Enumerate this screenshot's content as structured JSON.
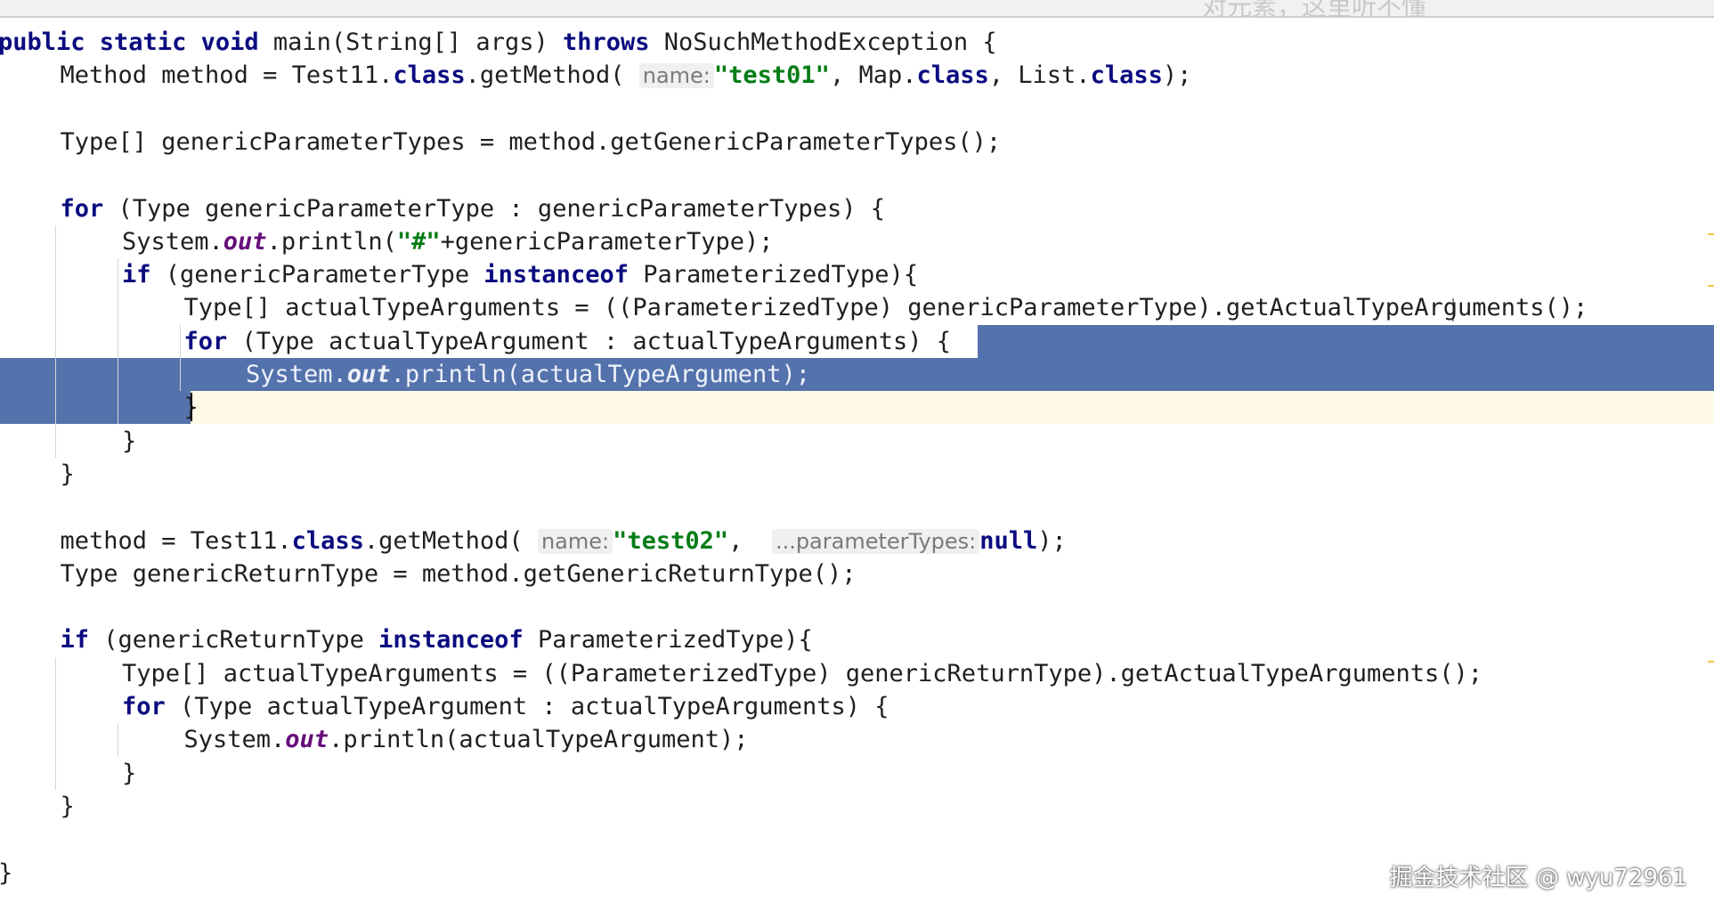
{
  "top_note": "对元素，这里听不懂",
  "editor": {
    "lines": [
      {
        "id": "l1",
        "indent": 0,
        "tokens": [
          [
            "kw",
            "public static void "
          ],
          [
            "",
            "main(String[] args) "
          ],
          [
            "kw",
            "throws "
          ],
          [
            "",
            "NoSuchMethodException {"
          ]
        ]
      },
      {
        "id": "l2",
        "indent": 1,
        "tokens": [
          [
            "",
            "Method method = Test11."
          ],
          [
            "kw",
            "class"
          ],
          [
            "",
            ".getMethod( "
          ],
          [
            "hint",
            "name:"
          ],
          [
            "str",
            "\"test01\""
          ],
          [
            "",
            ", Map."
          ],
          [
            "kw",
            "class"
          ],
          [
            "",
            ", List."
          ],
          [
            "kw",
            "class"
          ],
          [
            "",
            ");"
          ]
        ]
      },
      {
        "id": "l3",
        "indent": 0,
        "tokens": []
      },
      {
        "id": "l4",
        "indent": 1,
        "tokens": [
          [
            "",
            "Type[] genericParameterTypes = method.getGenericParameterTypes();"
          ]
        ]
      },
      {
        "id": "l5",
        "indent": 0,
        "tokens": []
      },
      {
        "id": "l6",
        "indent": 1,
        "tokens": [
          [
            "kw",
            "for "
          ],
          [
            "",
            "(Type genericParameterType : genericParameterTypes) {"
          ]
        ]
      },
      {
        "id": "l7",
        "indent": 2,
        "tokens": [
          [
            "",
            "System."
          ],
          [
            "fld",
            "out"
          ],
          [
            "",
            ".println("
          ],
          [
            "str",
            "\"#\""
          ],
          [
            "",
            "+genericParameterType);"
          ]
        ]
      },
      {
        "id": "l8",
        "indent": 2,
        "tokens": [
          [
            "kw",
            "if "
          ],
          [
            "",
            "(genericParameterType "
          ],
          [
            "kw",
            "instanceof "
          ],
          [
            "",
            "ParameterizedType){"
          ]
        ]
      },
      {
        "id": "l9",
        "indent": 3,
        "tokens": [
          [
            "",
            "Type[] actualTypeArguments = ((ParameterizedType) genericParameterType).getActualTypeArguments();"
          ]
        ]
      },
      {
        "id": "l10",
        "indent": 3,
        "tokens": [
          [
            "kw",
            "for "
          ],
          [
            "",
            "(Type actualTypeArgument : actualTypeArguments) {"
          ]
        ]
      },
      {
        "id": "l11",
        "indent": 4,
        "tokens": [
          [
            "",
            "System."
          ],
          [
            "fld",
            "out"
          ],
          [
            "",
            ".println(actualTypeArgument);"
          ]
        ]
      },
      {
        "id": "l12",
        "indent": 3,
        "tokens": [
          [
            "",
            "}"
          ]
        ]
      },
      {
        "id": "l13",
        "indent": 2,
        "tokens": [
          [
            "",
            "}"
          ]
        ]
      },
      {
        "id": "l14",
        "indent": 1,
        "tokens": [
          [
            "",
            "}"
          ]
        ]
      },
      {
        "id": "l15",
        "indent": 0,
        "tokens": []
      },
      {
        "id": "l16",
        "indent": 1,
        "tokens": [
          [
            "",
            "method = Test11."
          ],
          [
            "kw",
            "class"
          ],
          [
            "",
            ".getMethod( "
          ],
          [
            "hint",
            "name:"
          ],
          [
            "str",
            "\"test02\""
          ],
          [
            "",
            ",  "
          ],
          [
            "hint",
            "...parameterTypes:"
          ],
          [
            "kw",
            "null"
          ],
          [
            "",
            ");"
          ]
        ]
      },
      {
        "id": "l17",
        "indent": 1,
        "tokens": [
          [
            "",
            "Type genericReturnType = method.getGenericReturnType();"
          ]
        ]
      },
      {
        "id": "l18",
        "indent": 0,
        "tokens": []
      },
      {
        "id": "l19",
        "indent": 1,
        "tokens": [
          [
            "kw",
            "if "
          ],
          [
            "",
            "(genericReturnType "
          ],
          [
            "kw",
            "instanceof "
          ],
          [
            "",
            "ParameterizedType){"
          ]
        ]
      },
      {
        "id": "l20",
        "indent": 2,
        "tokens": [
          [
            "",
            "Type[] actualTypeArguments = ((ParameterizedType) genericReturnType).getActualTypeArguments();"
          ]
        ]
      },
      {
        "id": "l21",
        "indent": 2,
        "tokens": [
          [
            "kw",
            "for "
          ],
          [
            "",
            "(Type actualTypeArgument : actualTypeArguments) {"
          ]
        ]
      },
      {
        "id": "l22",
        "indent": 3,
        "tokens": [
          [
            "",
            "System."
          ],
          [
            "fld",
            "out"
          ],
          [
            "",
            ".println(actualTypeArgument);"
          ]
        ]
      },
      {
        "id": "l23",
        "indent": 2,
        "tokens": [
          [
            "",
            "}"
          ]
        ]
      },
      {
        "id": "l24",
        "indent": 1,
        "tokens": [
          [
            "",
            "}"
          ]
        ]
      },
      {
        "id": "l25",
        "indent": 0,
        "tokens": []
      },
      {
        "id": "l26",
        "indent": 0,
        "tokens": [
          [
            "",
            "}"
          ]
        ]
      }
    ]
  },
  "watermark": "掘金技术社区 @ wyu72961"
}
